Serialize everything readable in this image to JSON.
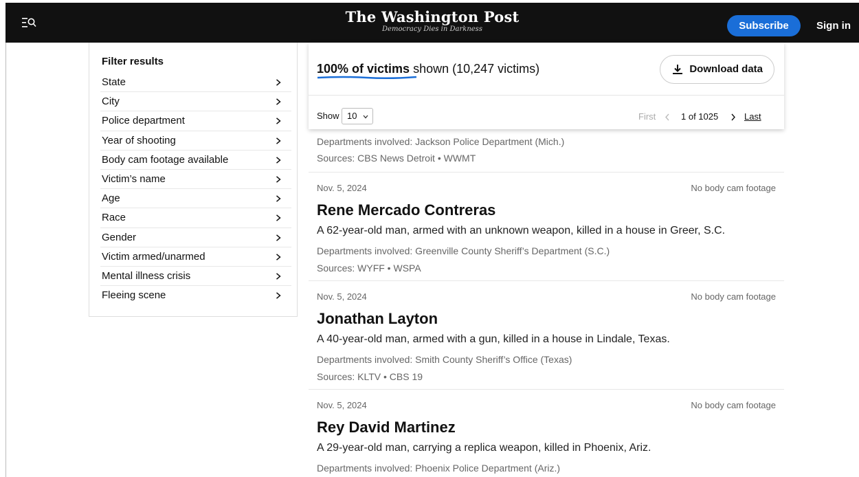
{
  "header": {
    "logo_title": "The Washington Post",
    "logo_tagline": "Democracy Dies in Darkness",
    "subscribe_label": "Subscribe",
    "signin_label": "Sign in",
    "menu_icon": "menu-search-icon"
  },
  "filters": {
    "title": "Filter results",
    "items": [
      {
        "label": "State"
      },
      {
        "label": "City"
      },
      {
        "label": "Police department"
      },
      {
        "label": "Year of shooting"
      },
      {
        "label": "Body cam footage available"
      },
      {
        "label": "Victim’s name"
      },
      {
        "label": "Age"
      },
      {
        "label": "Race"
      },
      {
        "label": "Gender"
      },
      {
        "label": "Victim armed/unarmed"
      },
      {
        "label": "Mental illness crisis"
      },
      {
        "label": "Fleeing scene"
      }
    ]
  },
  "summary": {
    "percent_text": "100% of victims",
    "rest_text": " shown (10,247 victims)",
    "download_label": "Download data",
    "accent": "#1a6ed8"
  },
  "pagination": {
    "show_label": "Show",
    "page_size": "10",
    "first_label": "First",
    "status": "1 of 1025",
    "last_label": "Last"
  },
  "partial_record": {
    "departments": "Departments involved: Jackson Police Department (Mich.)",
    "sources": "Sources: CBS News Detroit • WWMT"
  },
  "records": [
    {
      "date": "Nov. 5, 2024",
      "bodycam": "No body cam footage",
      "name": "Rene Mercado Contreras",
      "description": "A 62-year-old man, armed with an unknown weapon, killed in a house in Greer, S.C.",
      "departments": "Departments involved: Greenville County Sheriff’s Department (S.C.)",
      "sources": "Sources: WYFF • WSPA"
    },
    {
      "date": "Nov. 5, 2024",
      "bodycam": "No body cam footage",
      "name": "Jonathan Layton",
      "description": "A 40-year-old man, armed with a gun, killed in a house in Lindale, Texas.",
      "departments": "Departments involved: Smith County Sheriff’s Office (Texas)",
      "sources": "Sources: KLTV • CBS 19"
    },
    {
      "date": "Nov. 5, 2024",
      "bodycam": "No body cam footage",
      "name": "Rey David Martinez",
      "description": "A 29-year-old man, carrying a replica weapon, killed in Phoenix, Ariz.",
      "departments": "Departments involved: Phoenix Police Department (Ariz.)",
      "sources": ""
    }
  ]
}
